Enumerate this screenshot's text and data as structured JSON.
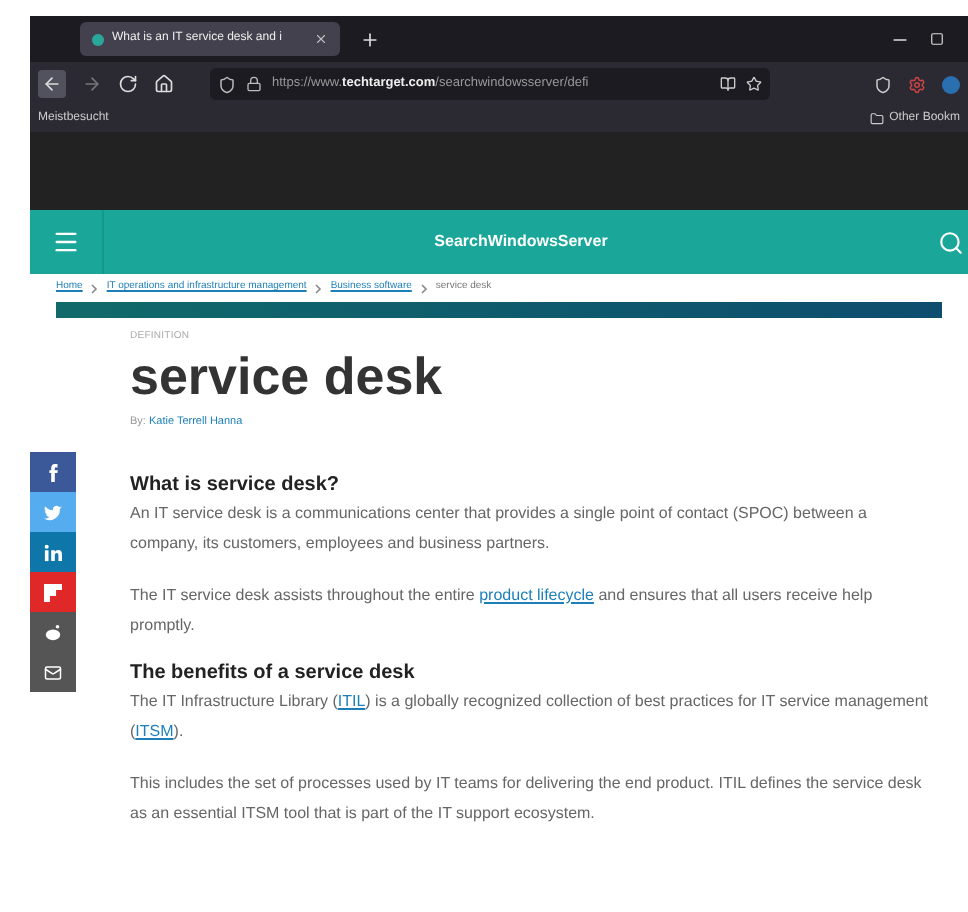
{
  "browser": {
    "tab": {
      "title": "What is an IT service desk and i",
      "selected": true
    },
    "url": {
      "prefix": "https://www.",
      "domain": "techtarget.com",
      "path": "/searchwindowsserver/defi"
    },
    "bookmarks": [
      "Meistbesucht"
    ],
    "other_bookmarks": "Other Bookm"
  },
  "site": {
    "name": "SearchWindowsServer"
  },
  "breadcrumbs": [
    "Home",
    "IT operations and infrastructure management",
    "Business software",
    "service desk"
  ],
  "article": {
    "label": "DEFINITION",
    "title": "service desk",
    "byline": "By: ",
    "author": "Katie Terrell Hanna",
    "share": [
      {
        "kind": "facebook",
        "color": "#3b5998"
      },
      {
        "kind": "twitter",
        "color": "#55acee"
      },
      {
        "kind": "linkedin",
        "color": "#0e76a8"
      },
      {
        "kind": "flipboard",
        "color": "#e12828"
      },
      {
        "kind": "reddit",
        "color": "#555555"
      },
      {
        "kind": "email",
        "color": "#555555"
      }
    ],
    "sections": [
      {
        "heading": "What is service desk?",
        "paragraphs": [
          [
            {
              "text": "An IT service desk is a communications center that provides a single point of contact (SPOC) between a company, its customers, employees and business partners."
            }
          ],
          [
            {
              "text": "The IT service desk assists throughout the entire "
            },
            {
              "text": "product lifecycle",
              "link": true
            },
            {
              "text": " and ensures that all users receive help promptly."
            }
          ]
        ]
      },
      {
        "heading": "The benefits of a service desk",
        "paragraphs": [
          [
            {
              "text": "The IT Infrastructure Library ("
            },
            {
              "text": "ITIL",
              "link": true
            },
            {
              "text": ") is a globally recognized collection of best practices for IT service management ("
            },
            {
              "text": "ITSM",
              "link": true
            },
            {
              "text": ")."
            }
          ],
          [
            {
              "text": "This includes the set of processes used by IT teams for delivering the end product. ITIL defines the service desk as an essential ITSM tool that is part of the IT support ecosystem."
            }
          ]
        ]
      }
    ]
  }
}
